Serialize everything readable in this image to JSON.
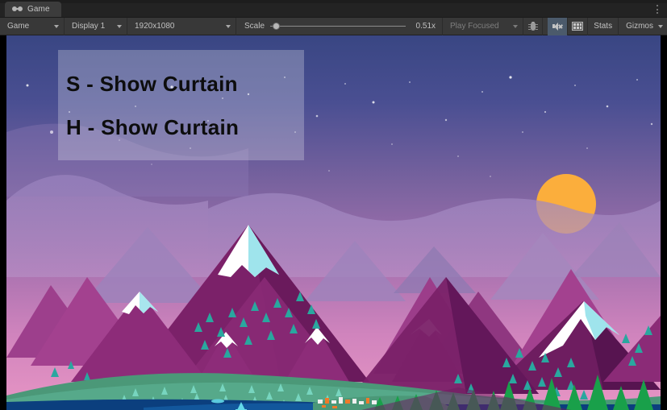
{
  "window": {
    "tab": {
      "label": "Game",
      "icon": "game-goggles-icon"
    },
    "menu_icon": "kebab-menu-icon"
  },
  "toolbar": {
    "game_dropdown": {
      "label": "Game",
      "icon": "chevron-down-icon"
    },
    "display_dropdown": {
      "label": "Display 1",
      "icon": "chevron-down-icon"
    },
    "resolution_dropdown": {
      "label": "1920x1080",
      "icon": "chevron-down-icon"
    },
    "scale": {
      "label": "Scale",
      "value": "0.51x",
      "slider_position_pct": 2
    },
    "play_mode_dropdown": {
      "label": "Play Focused",
      "icon": "chevron-down-icon"
    },
    "debug_button": {
      "icon": "bug-icon",
      "tooltip": ""
    },
    "mute_button": {
      "icon": "mute-audio-icon",
      "pressed": true
    },
    "stats_grid_button": {
      "icon": "aspect-grid-icon"
    },
    "stats_button": {
      "label": "Stats"
    },
    "gizmos_button": {
      "label": "Gizmos",
      "icon": "chevron-down-icon"
    }
  },
  "game": {
    "overlay": {
      "line1": "S - Show Curtain",
      "line2": "H - Show Curtain"
    },
    "scene": {
      "name": "low-poly-mountain-sunset",
      "colors": {
        "sky_top": "#3e4a8e",
        "sky_mid": "#8a6ba6",
        "sky_bottom": "#e08cc0",
        "sun": "#fbae3c",
        "haze_hill": "#9a7fb8",
        "mountain_light": "#a87fb5",
        "mountain_mid": "#9b60a0",
        "mountain_magenta": "#a43d8c",
        "mountain_deep": "#6e1e5c",
        "mountain_dark": "#521a48",
        "snow": "#ffffff",
        "snow_shade": "#9fe4ec",
        "meadow": "#4f9b78",
        "meadow_light": "#55a98a",
        "water_deep": "#0b3f7e",
        "water_mid": "#1562a8",
        "pine_foreground": "#19a04a",
        "pine_small": "#2aa8a0",
        "village_white": "#f2f2f2",
        "village_orange": "#ef7a2a"
      },
      "elements": [
        "stars",
        "sun",
        "haze-hills",
        "mountains",
        "snow-caps",
        "pine-trees",
        "meadow",
        "lake",
        "sailboat",
        "village"
      ]
    }
  }
}
